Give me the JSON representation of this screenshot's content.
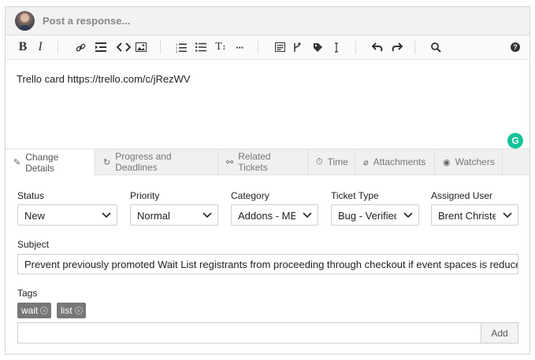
{
  "header": {
    "placeholder": "Post a response..."
  },
  "toolbar": {
    "bold": "B",
    "italic": "I",
    "heading": "T",
    "more": "···",
    "help": "?"
  },
  "editor": {
    "content": "Trello card https://trello.com/c/jRezWV"
  },
  "grammarly": {
    "label": "G"
  },
  "tabs": [
    {
      "label": "Change Details",
      "icon": "edit-icon"
    },
    {
      "label": "Progress and Deadlines",
      "icon": "refresh-icon"
    },
    {
      "label": "Related Tickets",
      "icon": "link-icon"
    },
    {
      "label": "Time",
      "icon": "stopwatch-icon"
    },
    {
      "label": "Attachments",
      "icon": "paperclip-icon"
    },
    {
      "label": "Watchers",
      "icon": "eye-icon"
    }
  ],
  "fields": {
    "status": {
      "label": "Status",
      "value": "New"
    },
    "priority": {
      "label": "Priority",
      "value": "Normal"
    },
    "category": {
      "label": "Category",
      "value": "Addons - ME"
    },
    "ticket_type": {
      "label": "Ticket Type",
      "value": "Bug - Verified"
    },
    "assigned_user": {
      "label": "Assigned User",
      "value": "Brent Christensen"
    },
    "subject": {
      "label": "Subject",
      "value": "Prevent previously promoted Wait List registrants from proceeding through checkout if event spaces is reduced"
    },
    "tags": {
      "label": "Tags",
      "items": [
        "wait",
        "list"
      ],
      "add_label": "Add"
    }
  },
  "colors": {
    "grammarly": "#15c39a",
    "tag_bg": "#777777"
  }
}
